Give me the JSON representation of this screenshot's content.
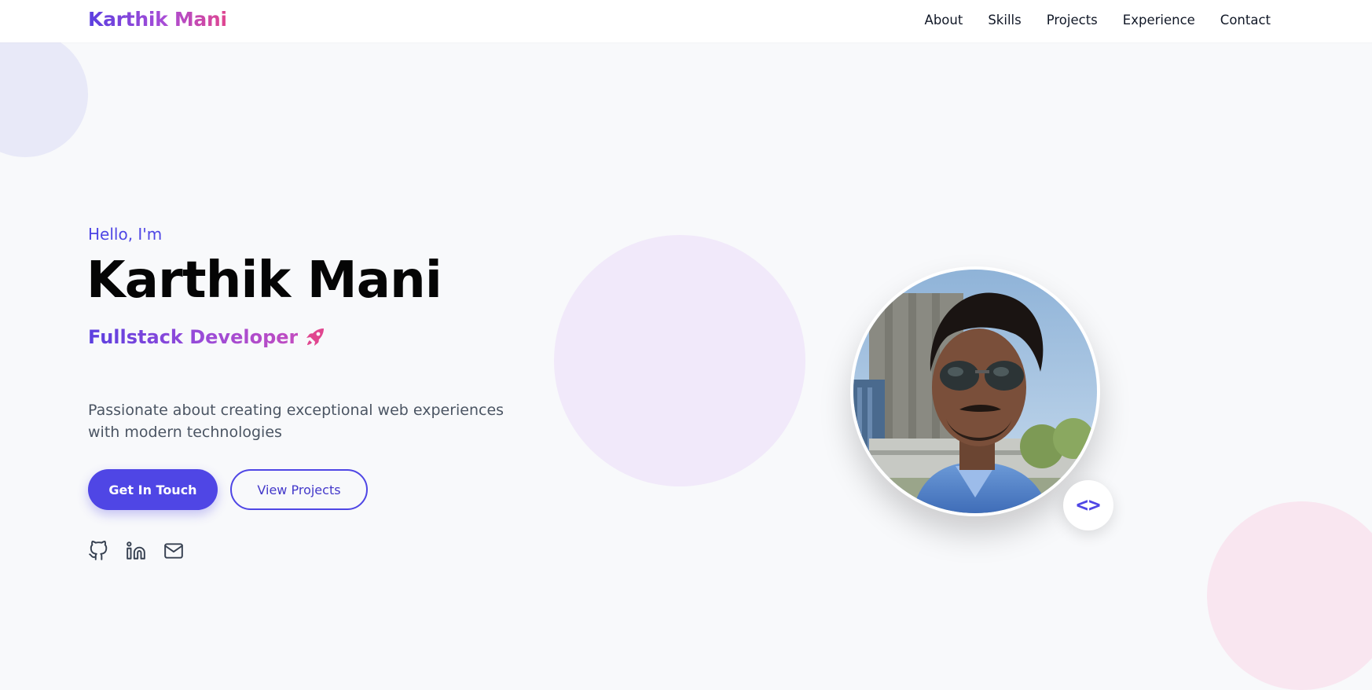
{
  "nav": {
    "brand": "Karthik Mani",
    "links": [
      {
        "label": "About"
      },
      {
        "label": "Skills"
      },
      {
        "label": "Projects"
      },
      {
        "label": "Experience"
      },
      {
        "label": "Contact"
      }
    ]
  },
  "hero": {
    "greeting": "Hello, I'm",
    "name": "Karthik Mani",
    "role": "Fullstack Developer",
    "role_icon": "rocket-icon",
    "description": "Passionate about creating exceptional web experiences with modern technologies",
    "primary_button": "Get In Touch",
    "secondary_button": "View Projects",
    "socials": [
      {
        "icon": "github-icon"
      },
      {
        "icon": "linkedin-icon"
      },
      {
        "icon": "mail-icon"
      }
    ],
    "badge_glyph": "<>"
  },
  "colors": {
    "accent": "#4f46e5",
    "brand_gradient_start": "#5b3fe0",
    "brand_gradient_end": "#e0468f",
    "background": "#f8f9fb"
  }
}
